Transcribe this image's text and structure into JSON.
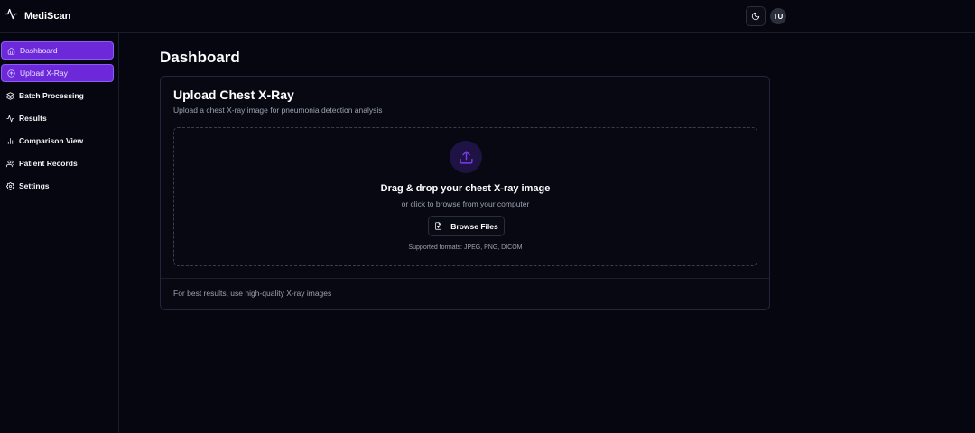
{
  "app": {
    "name": "MediScan"
  },
  "header": {
    "avatar_initials": "TU"
  },
  "sidebar": {
    "items": [
      {
        "label": "Dashboard",
        "icon": "home-icon",
        "active": true
      },
      {
        "label": "Upload X-Ray",
        "icon": "upload-icon",
        "active": true
      },
      {
        "label": "Batch Processing",
        "icon": "layers-icon",
        "active": false
      },
      {
        "label": "Results",
        "icon": "activity-icon",
        "active": false
      },
      {
        "label": "Comparison View",
        "icon": "bar-chart-icon",
        "active": false
      },
      {
        "label": "Patient Records",
        "icon": "users-icon",
        "active": false
      },
      {
        "label": "Settings",
        "icon": "gear-icon",
        "active": false
      }
    ]
  },
  "main": {
    "title": "Dashboard",
    "card": {
      "title": "Upload Chest X-Ray",
      "subtitle": "Upload a chest X-ray image for pneumonia detection analysis",
      "dropzone": {
        "title": "Drag & drop your chest X-ray image",
        "subtitle": "or click to browse from your computer",
        "button_label": "Browse Files",
        "formats": "Supported formats: JPEG, PNG, DICOM"
      },
      "footer": "For best results, use high-quality X-ray images"
    }
  },
  "colors": {
    "background": "#05060f",
    "accent": "#6d28d9",
    "accent_light": "#8b5cf6",
    "border": "#1c1f2b",
    "muted_text": "#9ca3af"
  }
}
